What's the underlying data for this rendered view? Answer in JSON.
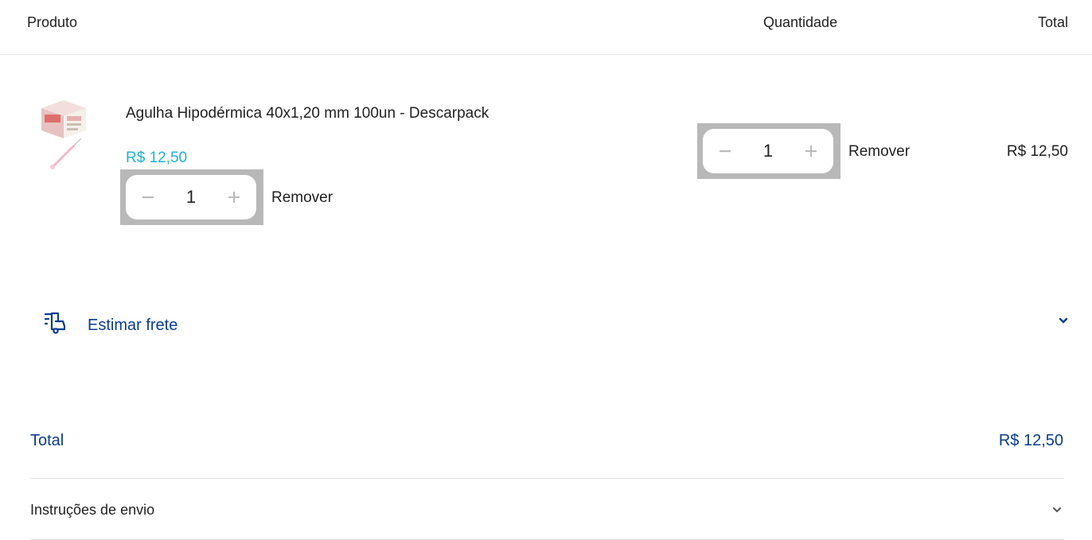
{
  "colors": {
    "link_blue": "#0a3d8f",
    "price_cyan": "#1fb3d6",
    "stepper_bg": "#b8b8b8"
  },
  "table_header": {
    "product": "Produto",
    "quantity": "Quantidade",
    "total": "Total"
  },
  "item": {
    "name": "Agulha Hipodérmica 40x1,20 mm 100un - Descarpack",
    "price": "R$ 12,50",
    "quantity": "1",
    "remove_label": "Remover",
    "line_total": "R$ 12,50",
    "image_icon": "needle-box-image",
    "minus_icon": "minus-icon",
    "plus_icon": "plus-icon"
  },
  "shipping_estimate": {
    "label": "Estimar frete",
    "icon": "truck-icon",
    "toggle_icon": "chevron-down-icon"
  },
  "summary": {
    "total_label": "Total",
    "total_value": "R$ 12,50"
  },
  "shipping_instructions": {
    "label": "Instruções de envio",
    "toggle_icon": "chevron-down-icon"
  }
}
